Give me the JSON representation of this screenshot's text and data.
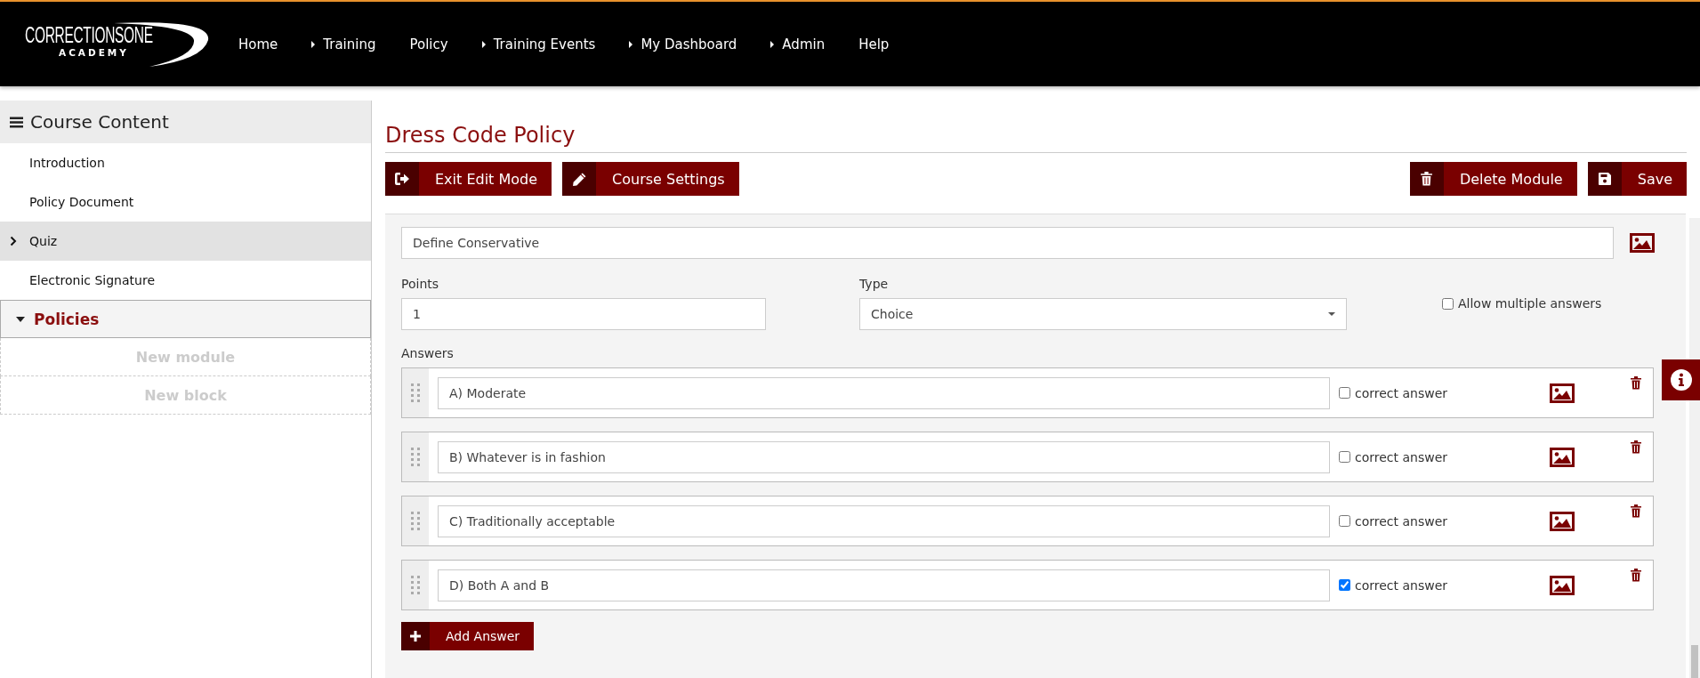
{
  "logo": {
    "name": "CORRECTIONSONE",
    "subtitle": "ACADEMY"
  },
  "nav": [
    {
      "label": "Home",
      "has_submenu": false
    },
    {
      "label": "Training",
      "has_submenu": true
    },
    {
      "label": "Policy",
      "has_submenu": false
    },
    {
      "label": "Training Events",
      "has_submenu": true
    },
    {
      "label": "My Dashboard",
      "has_submenu": true
    },
    {
      "label": "Admin",
      "has_submenu": true
    },
    {
      "label": "Help",
      "has_submenu": false
    }
  ],
  "sidebar": {
    "title": "Course Content",
    "items": [
      {
        "label": "Introduction",
        "selected": false
      },
      {
        "label": "Policy Document",
        "selected": false
      },
      {
        "label": "Quiz",
        "selected": true
      },
      {
        "label": "Electronic Signature",
        "selected": false
      }
    ],
    "section": {
      "label": "Policies",
      "expanded": true
    },
    "placeholders": [
      "New module",
      "New block"
    ]
  },
  "page_title": "Dress Code Policy",
  "toolbar": {
    "left": [
      {
        "label": "Exit Edit Mode"
      },
      {
        "label": "Course Settings"
      }
    ],
    "right": [
      {
        "label": "Delete Module"
      },
      {
        "label": "Save"
      }
    ]
  },
  "question": {
    "text": "Define Conservative",
    "points_label": "Points",
    "points": "1",
    "type_label": "Type",
    "type": "Choice",
    "allow_multiple": {
      "label": "Allow multiple answers",
      "checked": false
    },
    "answers_label": "Answers",
    "answers": [
      {
        "text": "A) Moderate",
        "label": "correct answer",
        "checked": false
      },
      {
        "text": "B) Whatever is in fashion",
        "label": "correct answer",
        "checked": false
      },
      {
        "text": "C) Traditionally acceptable",
        "label": "correct answer",
        "checked": false
      },
      {
        "text": "D) Both A and B",
        "label": "correct answer",
        "checked": true
      }
    ],
    "add_button": "Add Answer"
  }
}
